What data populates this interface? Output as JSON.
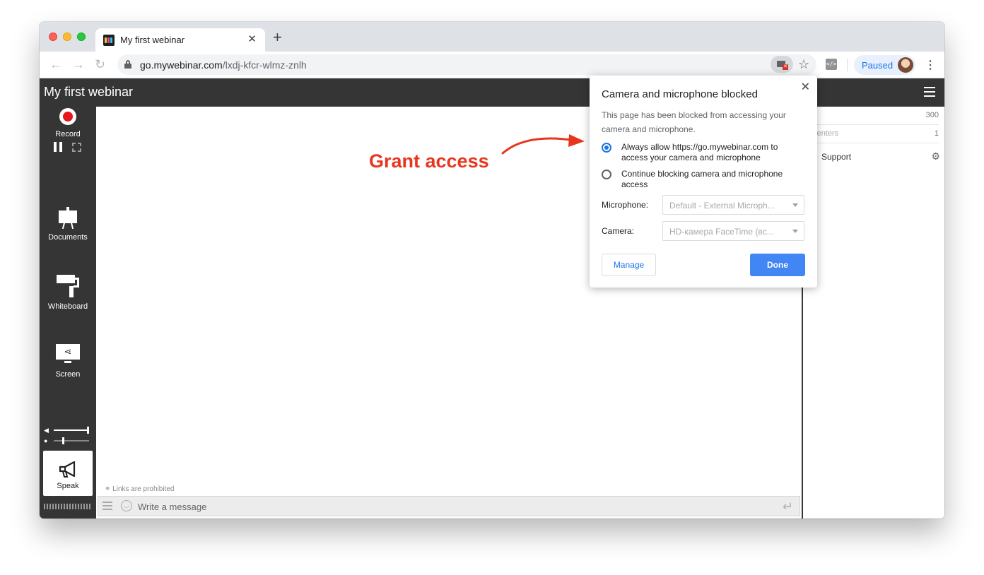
{
  "browser": {
    "tab_title": "My first webinar",
    "url_host": "go.mywebinar.com",
    "url_path": "/lxdj-kfcr-wlmz-znlh",
    "profile_label": "Paused"
  },
  "app": {
    "title": "My first webinar",
    "sidebar": {
      "record_label": "Record",
      "documents_label": "Documents",
      "whiteboard_label": "Whiteboard",
      "screen_label": "Screen",
      "speak_label": "Speak",
      "volume_level": 1.0,
      "mic_level": 0.25
    },
    "stage": {
      "annotation": "Grant access",
      "links_note": "Links are prohibited",
      "chat_placeholder": "Write a message"
    },
    "right_panel": {
      "top_count": "300",
      "presenters_label": "esenters",
      "presenters_count": "1",
      "support_name": "Support"
    }
  },
  "permission_popup": {
    "title": "Camera and microphone blocked",
    "description": "This page has been blocked from accessing your camera and microphone.",
    "options": [
      {
        "label": "Always allow https://go.mywebinar.com to access your camera and microphone",
        "selected": true
      },
      {
        "label": "Continue blocking camera and microphone access",
        "selected": false
      }
    ],
    "microphone_label": "Microphone:",
    "microphone_value": "Default - External Microph...",
    "camera_label": "Camera:",
    "camera_value": "HD-камера FaceTime (вс...",
    "manage_label": "Manage",
    "done_label": "Done"
  },
  "colors": {
    "annotation": "#e8361e",
    "app_dark": "#353535",
    "accent_blue": "#4285f4",
    "record_red": "#e7161b"
  }
}
